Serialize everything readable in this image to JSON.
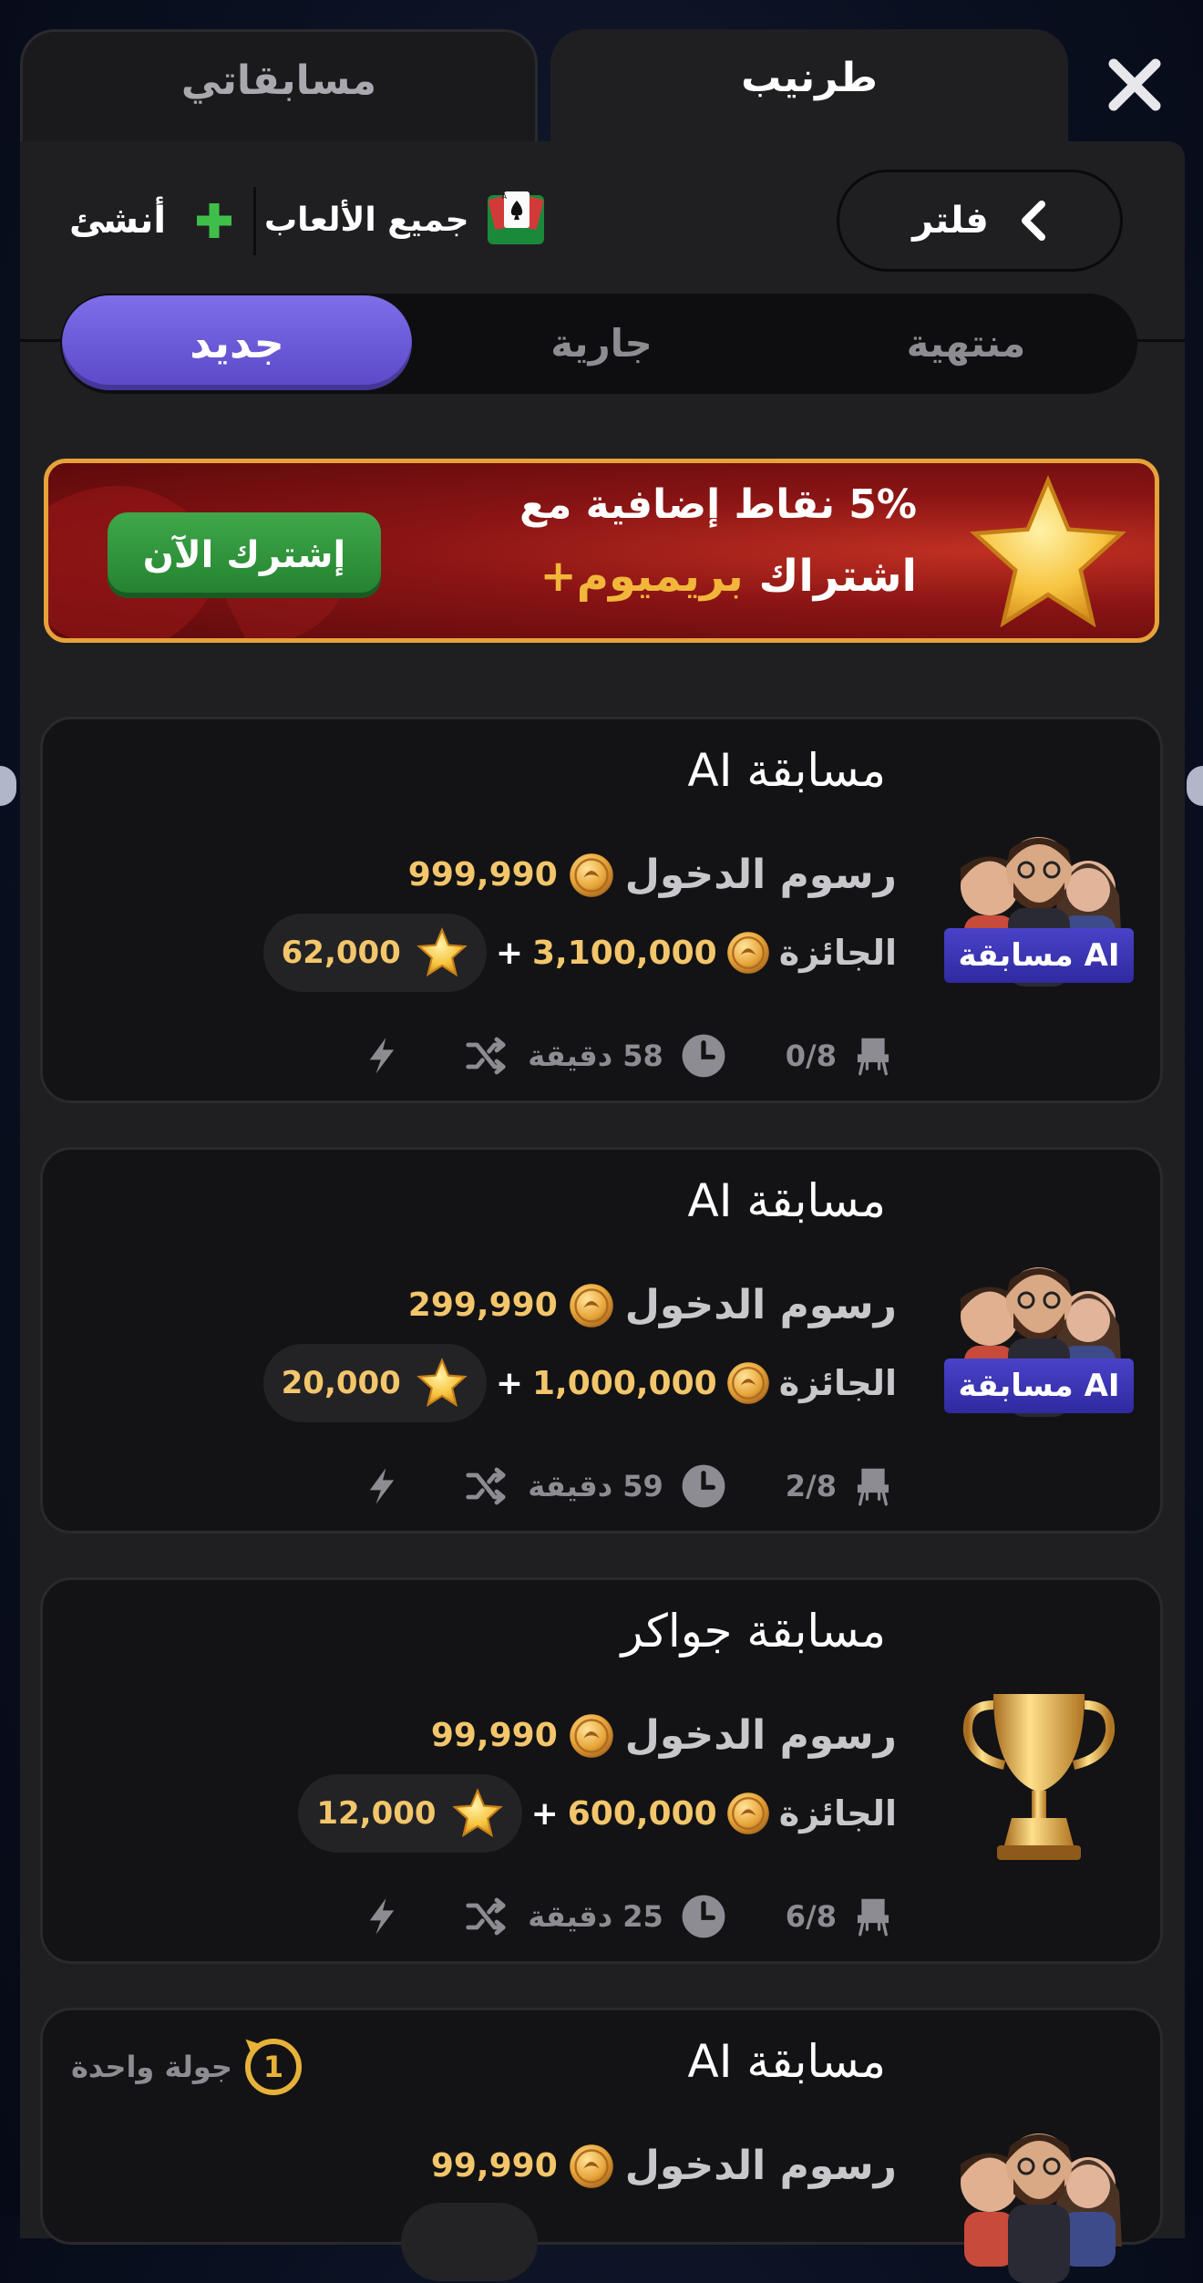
{
  "header": {
    "tab_active": "طرنيب",
    "tab_inactive": "مسابقاتي",
    "close_icon": "close-icon"
  },
  "toolbar": {
    "filter_label": "فلتر",
    "games_label": "جميع الألعاب",
    "create_label": "أنشئ"
  },
  "segments": {
    "new": "جديد",
    "ongoing": "جارية",
    "finished": "منتهية"
  },
  "banner": {
    "line1": "5% نقاط إضافية مع",
    "line2_a": "اشتراك",
    "line2_b": "بريميوم+",
    "button": "إشترك الآن"
  },
  "tournaments": [
    {
      "title": "مسابقة AI",
      "badge": "مسابقة AI",
      "fee_label": "رسوم الدخول",
      "fee": "999,990",
      "prize_label": "الجائزة",
      "prize": "3,100,000",
      "plus": "+",
      "points": "62,000",
      "time": "58 دقيقة",
      "seats": "0/8",
      "image": "ai-avatars"
    },
    {
      "title": "مسابقة AI",
      "badge": "مسابقة AI",
      "fee_label": "رسوم الدخول",
      "fee": "299,990",
      "prize_label": "الجائزة",
      "prize": "1,000,000",
      "plus": "+",
      "points": "20,000",
      "time": "59 دقيقة",
      "seats": "2/8",
      "image": "ai-avatars"
    },
    {
      "title": "مسابقة جواكر",
      "fee_label": "رسوم الدخول",
      "fee": "99,990",
      "prize_label": "الجائزة",
      "prize": "600,000",
      "plus": "+",
      "points": "12,000",
      "time": "25 دقيقة",
      "seats": "6/8",
      "image": "trophy"
    },
    {
      "title": "مسابقة AI",
      "round_label": "جولة واحدة",
      "round_num": "1",
      "fee_label": "رسوم الدخول",
      "fee": "99,990",
      "image": "ai-avatars"
    }
  ],
  "colors": {
    "accent_purple": "#6a5ad8",
    "gold": "#f3c66b",
    "green": "#2f9a3c",
    "card_bg": "#131315"
  }
}
